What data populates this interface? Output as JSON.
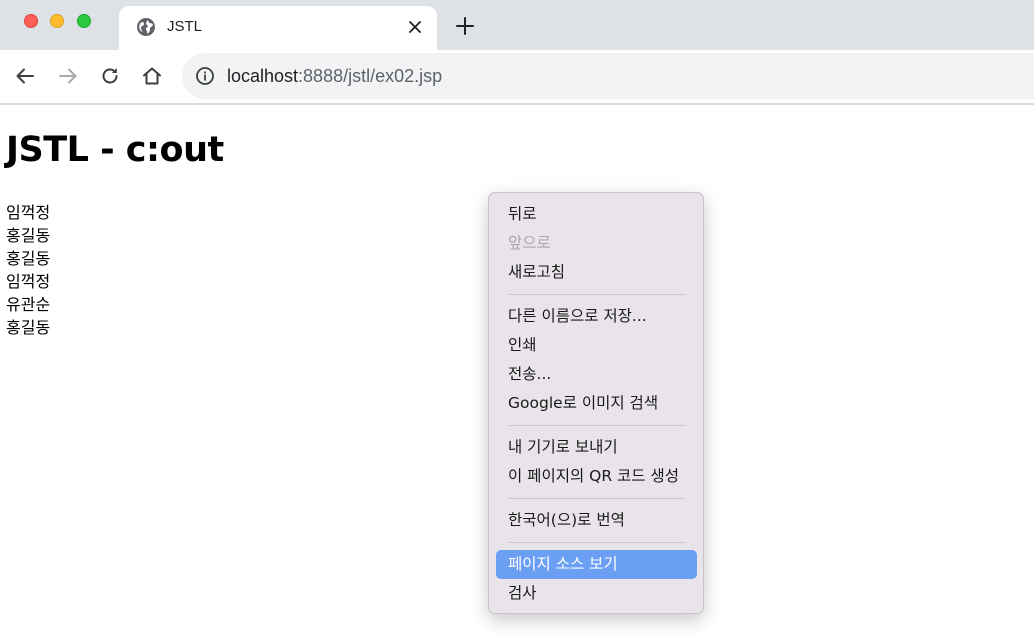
{
  "window": {
    "controls": [
      "close",
      "minimize",
      "maximize"
    ]
  },
  "tab": {
    "title": "JSTL",
    "favicon": "globe-icon"
  },
  "toolbar": {
    "url_host": "localhost",
    "url_path": ":8888/jstl/ex02.jsp"
  },
  "page": {
    "heading": "JSTL - c:out",
    "names": [
      "임꺽정",
      "홍길동",
      "홍길동",
      "임꺽정",
      "유관순",
      "홍길동"
    ]
  },
  "context_menu": {
    "items": {
      "back": "뒤로",
      "forward": "앞으로",
      "reload": "새로고침",
      "save_as": "다른 이름으로 저장...",
      "print": "인쇄",
      "cast": "전송...",
      "google_image_search": "Google로 이미지 검색",
      "send_to_devices": "내 기기로 보내기",
      "qr_code": "이 페이지의 QR 코드 생성",
      "translate": "한국어(으)로 번역",
      "view_source": "페이지 소스 보기",
      "inspect": "검사"
    },
    "disabled": [
      "forward"
    ],
    "highlighted": "view_source",
    "highlight_color": "#6a9ff4"
  },
  "colors": {
    "tabstrip_bg": "#dee1e6",
    "omnibox_bg": "#f1f3f4",
    "menu_bg": "#e8e4ea"
  }
}
